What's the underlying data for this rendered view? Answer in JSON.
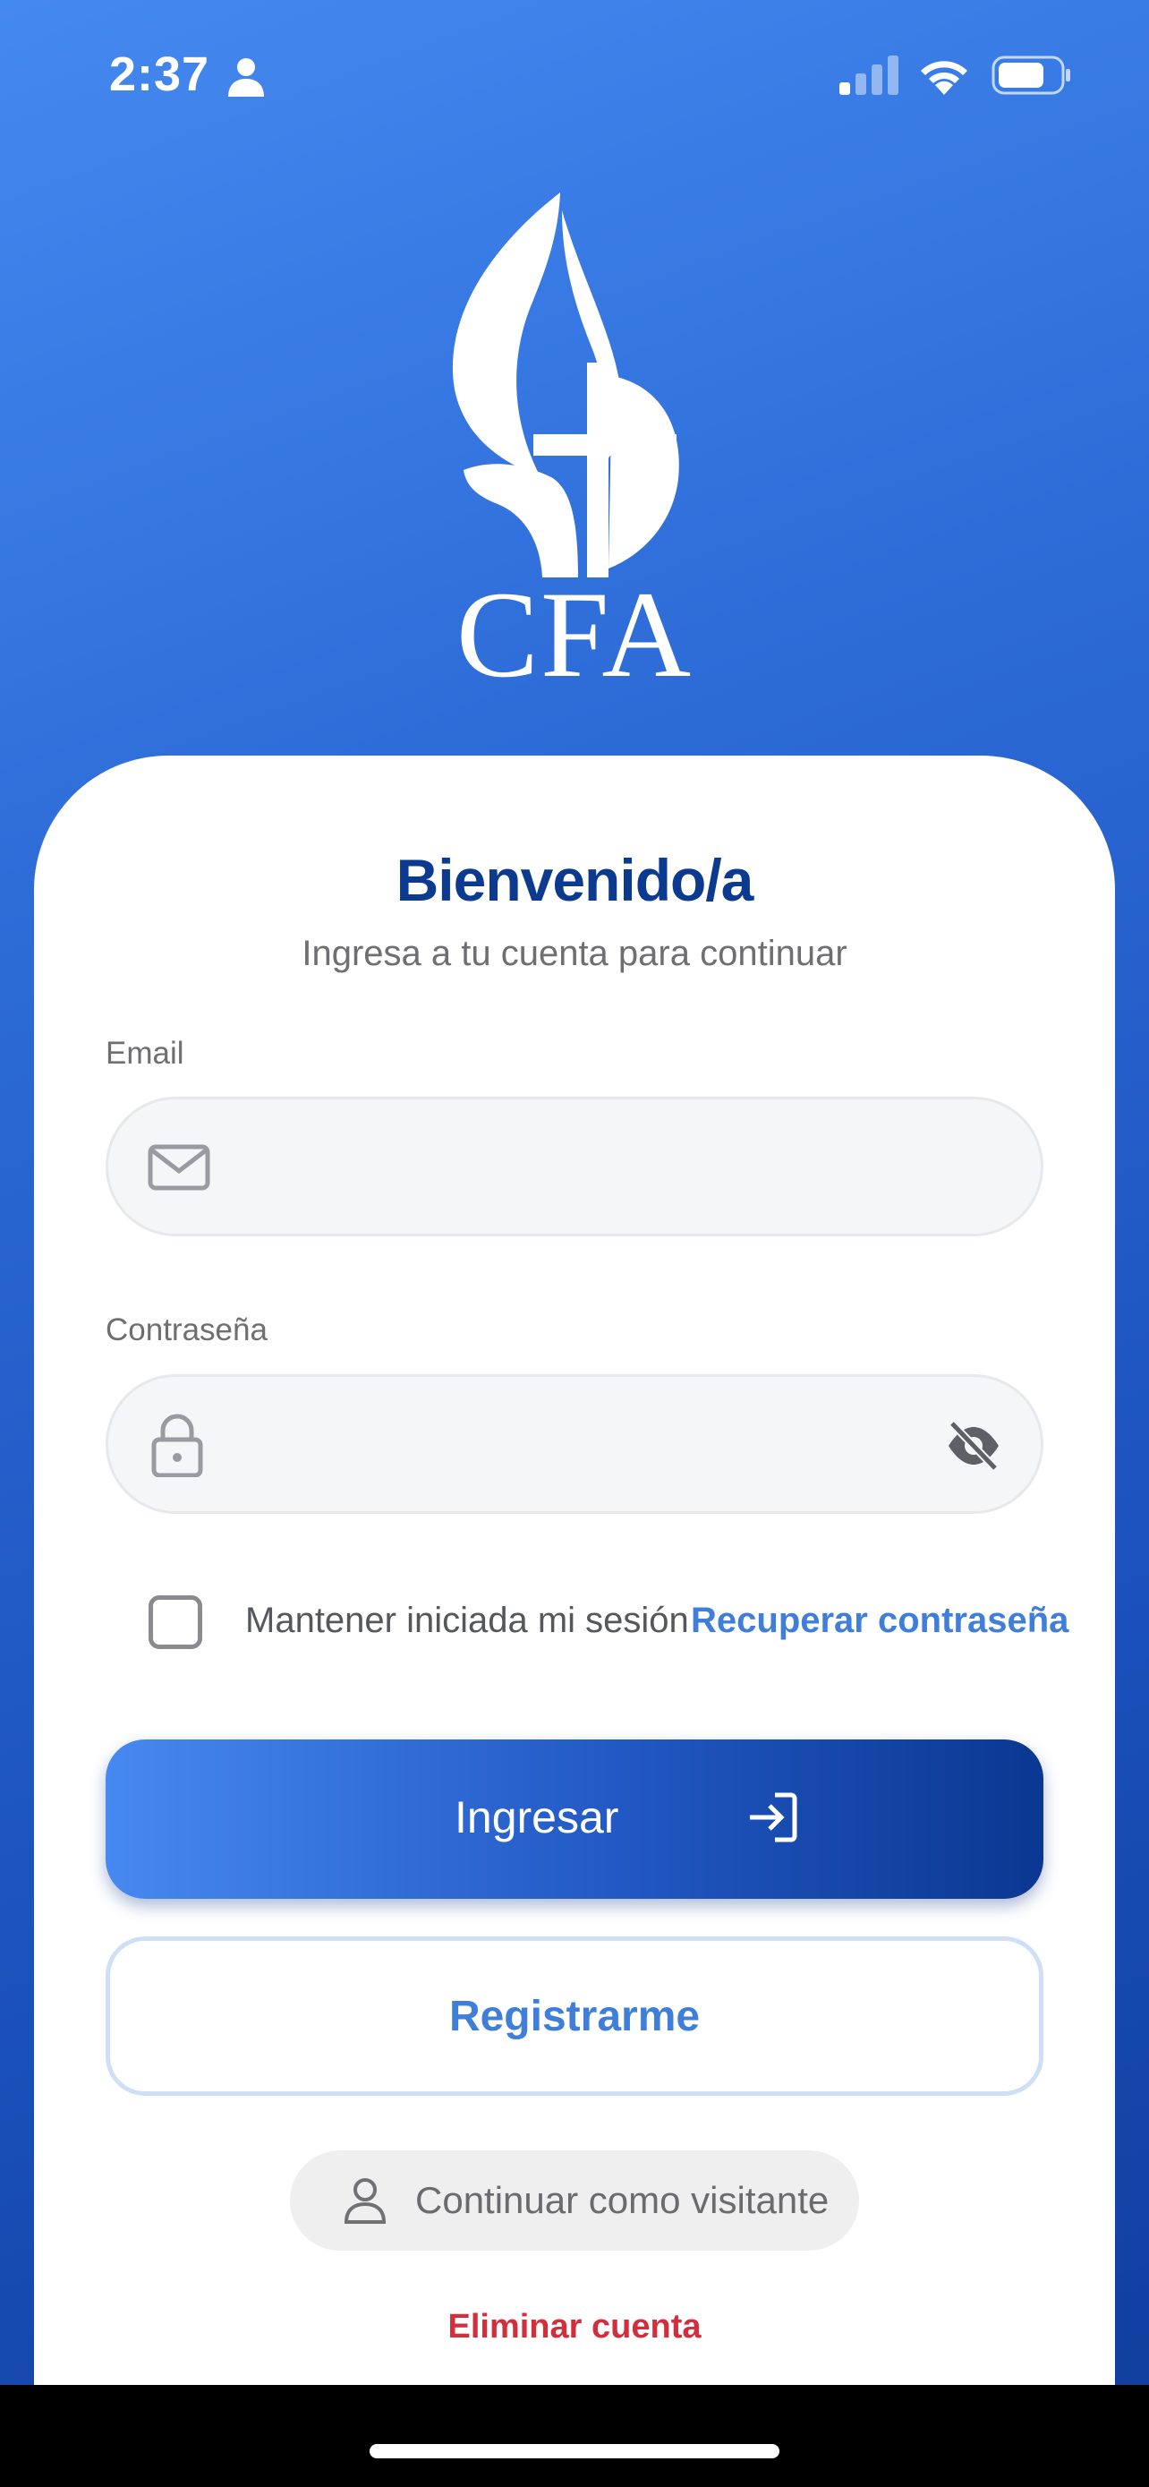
{
  "status_bar": {
    "time": "2:37",
    "icons": [
      "person-icon",
      "signal-icon",
      "wifi-icon",
      "battery-icon"
    ]
  },
  "logo": {
    "text": "CFA",
    "icon": "flame-dove-cross-logo"
  },
  "login": {
    "title": "Bienvenido/a",
    "subtitle": "Ingresa a tu cuenta para continuar",
    "email_label": "Email",
    "email_value": "",
    "password_label": "Contraseña",
    "password_value": "",
    "remember_label": "Mantener iniciada mi sesión",
    "remember_checked": false,
    "recover_link": "Recuperar contraseña",
    "submit_label": "Ingresar",
    "register_label": "Registrarme",
    "guest_label": "Continuar como visitante",
    "delete_label": "Eliminar cuenta"
  },
  "colors": {
    "background_gradient": [
      "#4489f0",
      "#0f3f9f"
    ],
    "title": "#0b3a8e",
    "link": "#3f7fd9",
    "danger": "#d22f3c"
  }
}
